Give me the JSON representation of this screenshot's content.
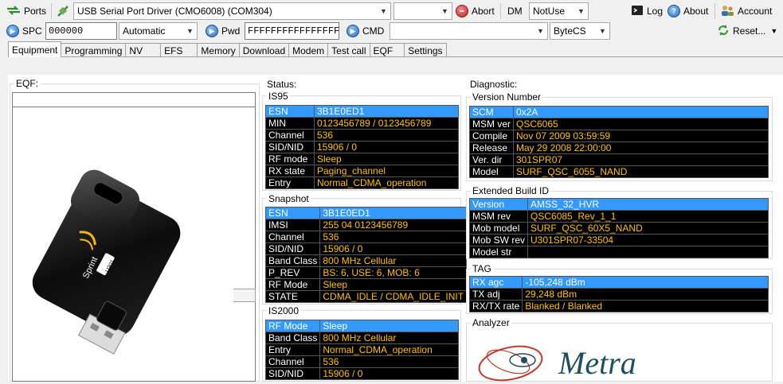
{
  "toolbar1": {
    "ports_label": "Ports",
    "driver_select": "USB Serial Port Driver (CMO6008) (COM304)",
    "empty_select": "",
    "abort_label": "Abort",
    "dm_label": "DM",
    "dm_select": "NotUse",
    "log_label": "Log",
    "about_label": "About",
    "account_label": "Account"
  },
  "toolbar2": {
    "spc_label": "SPC",
    "spc_value": "000000",
    "mode_select": "Automatic",
    "pwd_label": "Pwd",
    "pwd_value": "FFFFFFFFFFFFFFFF",
    "cmd_label": "CMD",
    "cmd_select": "",
    "bytecs_select": "ByteCS",
    "reset_label": "Reset..."
  },
  "tabs": [
    "Equipment",
    "Programming",
    "NV",
    "EFS",
    "Memory",
    "Download",
    "Modem",
    "Test call",
    "EQF",
    "Settings"
  ],
  "eqf": {
    "label": "EQF:"
  },
  "status": {
    "label": "Status:",
    "is95": {
      "title": "IS95",
      "rows": [
        {
          "k": "ESN",
          "v": "3B1E0ED1"
        },
        {
          "k": "MIN",
          "v": "0123456789 / 0123456789"
        },
        {
          "k": "Channel",
          "v": "536"
        },
        {
          "k": "SID/NID",
          "v": "15906 / 0"
        },
        {
          "k": "RF mode",
          "v": "Sleep"
        },
        {
          "k": "RX state",
          "v": "Paging_channel"
        },
        {
          "k": "Entry",
          "v": "Normal_CDMA_operation"
        }
      ]
    },
    "snapshot": {
      "title": "Snapshot",
      "rows": [
        {
          "k": "ESN",
          "v": "3B1E0ED1"
        },
        {
          "k": "IMSI",
          "v": "255 04 0123456789"
        },
        {
          "k": "Channel",
          "v": "536"
        },
        {
          "k": "SID/NID",
          "v": "15906 / 0"
        },
        {
          "k": "Band Class",
          "v": "800 MHz Cellular"
        },
        {
          "k": "P_REV",
          "v": "BS: 6, USE: 6, MOB: 6"
        },
        {
          "k": "RF Mode",
          "v": "Sleep"
        },
        {
          "k": "STATE",
          "v": "CDMA_IDLE / CDMA_IDLE_INIT"
        }
      ]
    },
    "is2000": {
      "title": "IS2000",
      "rows": [
        {
          "k": "RF Mode",
          "v": "Sleep"
        },
        {
          "k": "Band Class",
          "v": "800 MHz Cellular"
        },
        {
          "k": "Entry",
          "v": "Normal_CDMA_operation"
        },
        {
          "k": "Channel",
          "v": "536"
        },
        {
          "k": "SID/NID",
          "v": "15906 / 0"
        }
      ]
    }
  },
  "diagnostic": {
    "label": "Diagnostic:",
    "version": {
      "title": "Version Number",
      "rows": [
        {
          "k": "SCM",
          "v": "0x2A"
        },
        {
          "k": "MSM ver",
          "v": "QSC6065"
        },
        {
          "k": "Compile",
          "v": "Nov 07 2009 03:59:59"
        },
        {
          "k": "Release",
          "v": "May 29 2008 22:00:00"
        },
        {
          "k": "Ver. dir",
          "v": "301SPR07"
        },
        {
          "k": "Model",
          "v": "SURF_QSC_6055_NAND"
        }
      ]
    },
    "build": {
      "title": "Extended Build ID",
      "rows": [
        {
          "k": "Version",
          "v": "AMSS_32_HVR"
        },
        {
          "k": "MSM rev",
          "v": "QSC6085_Rev_1_1"
        },
        {
          "k": "Mob model",
          "v": "SURF_QSC_60X5_NAND"
        },
        {
          "k": "Mob SW rev",
          "v": "U301SPR07-33504"
        },
        {
          "k": "Model str",
          "v": ""
        }
      ]
    },
    "tag": {
      "title": "TAG",
      "rows": [
        {
          "k": "RX agc",
          "v": "-105,248 dBm"
        },
        {
          "k": "TX adj",
          "v": "29,248 dBm"
        },
        {
          "k": "RX/TX rate",
          "v": "Blanked / Blanked"
        }
      ]
    },
    "analyzer": {
      "title": "Analyzer",
      "logo_text": "Metra"
    }
  },
  "device_image": {
    "brand_text": "Sprint",
    "model_text": "U301"
  }
}
